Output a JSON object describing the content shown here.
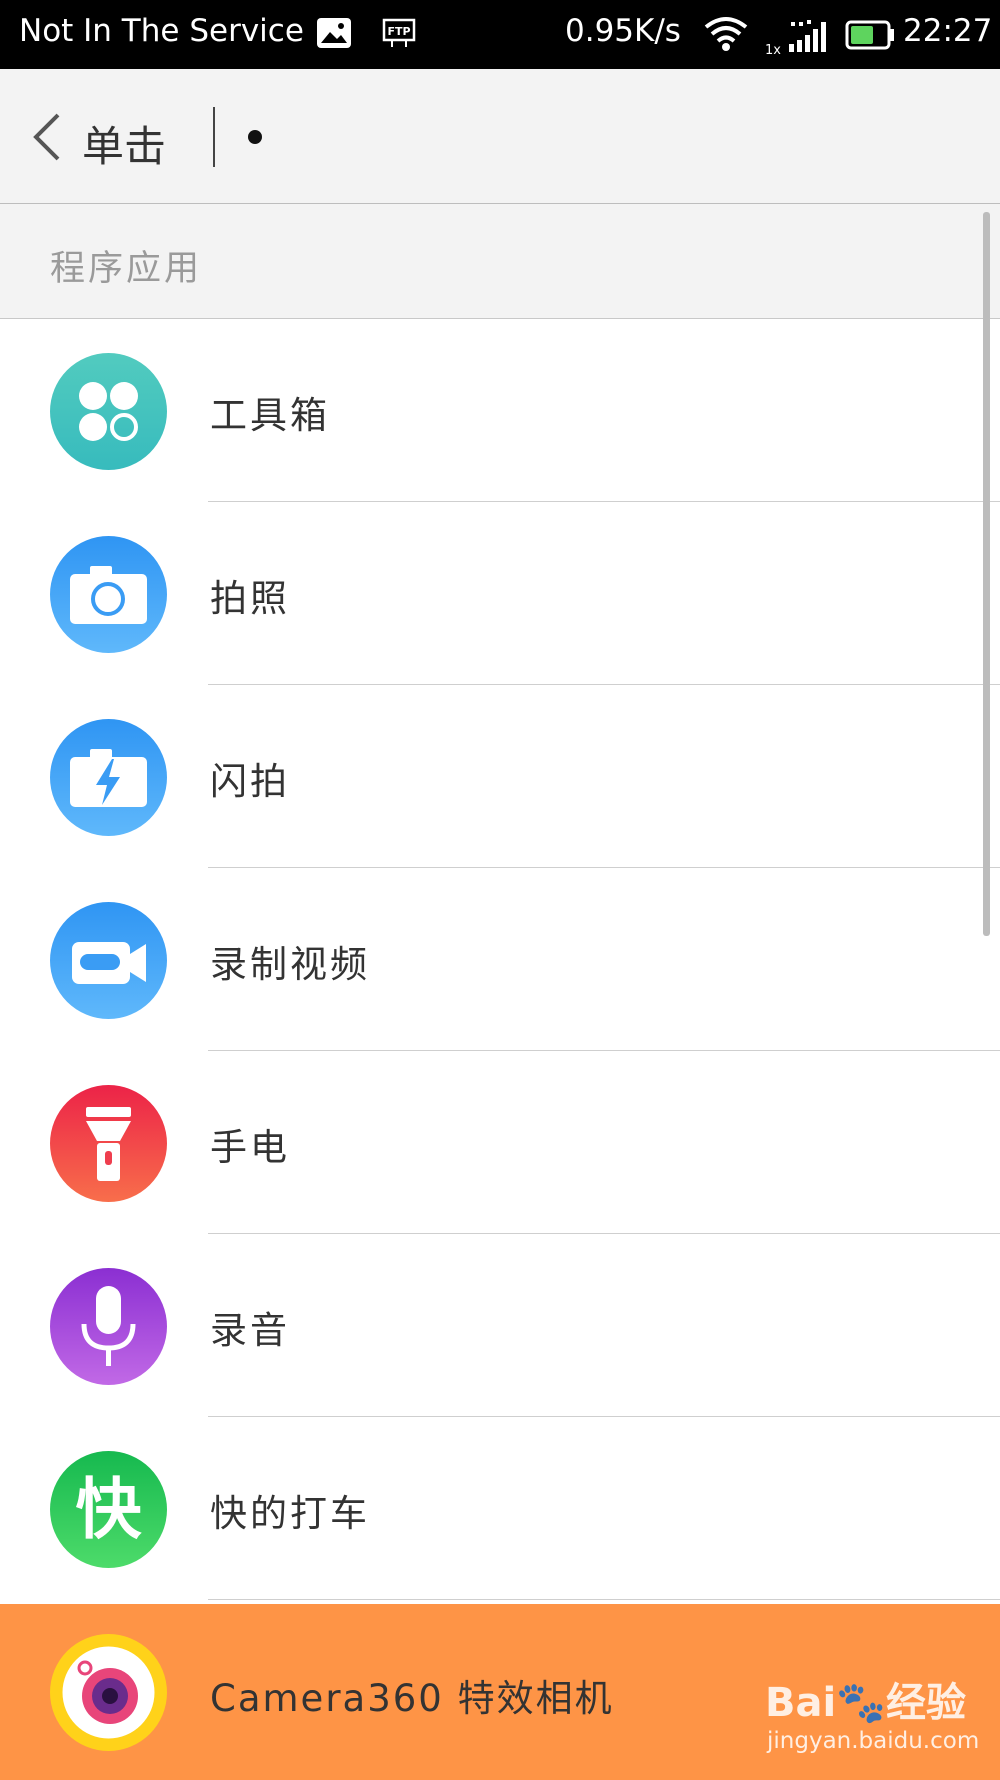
{
  "status_bar": {
    "carrier": "Not In The Service",
    "speed": "0.95K/s",
    "time": "22:27",
    "icons": [
      "image-icon",
      "ftp-icon",
      "wifi-icon",
      "signal-icon",
      "battery-icon"
    ]
  },
  "top_bar": {
    "back_label": "单击"
  },
  "section": {
    "title": "程序应用"
  },
  "list": {
    "items": [
      {
        "label": "工具箱",
        "icon": "toolbox-icon",
        "color": "#45c4be"
      },
      {
        "label": "拍照",
        "icon": "camera-icon",
        "color": "#3a9cf4"
      },
      {
        "label": "闪拍",
        "icon": "flash-camera-icon",
        "color": "#3a9cf4"
      },
      {
        "label": "录制视频",
        "icon": "video-camera-icon",
        "color": "#3a9cf4"
      },
      {
        "label": "手电",
        "icon": "flashlight-icon",
        "color": "#ef3e4e"
      },
      {
        "label": "录音",
        "icon": "microphone-icon",
        "color": "#9c49d8"
      },
      {
        "label": "快的打车",
        "icon": "kuaidi-icon",
        "glyph": "快",
        "color": "#25c55a"
      },
      {
        "label": "Camera360 特效相机",
        "icon": "camera360-icon",
        "color": "#ffd21a",
        "highlighted": true
      }
    ]
  },
  "highlight_color": "#fe9446",
  "watermark": {
    "brand": "Bai🐾经验",
    "url": "jingyan.baidu.com"
  }
}
